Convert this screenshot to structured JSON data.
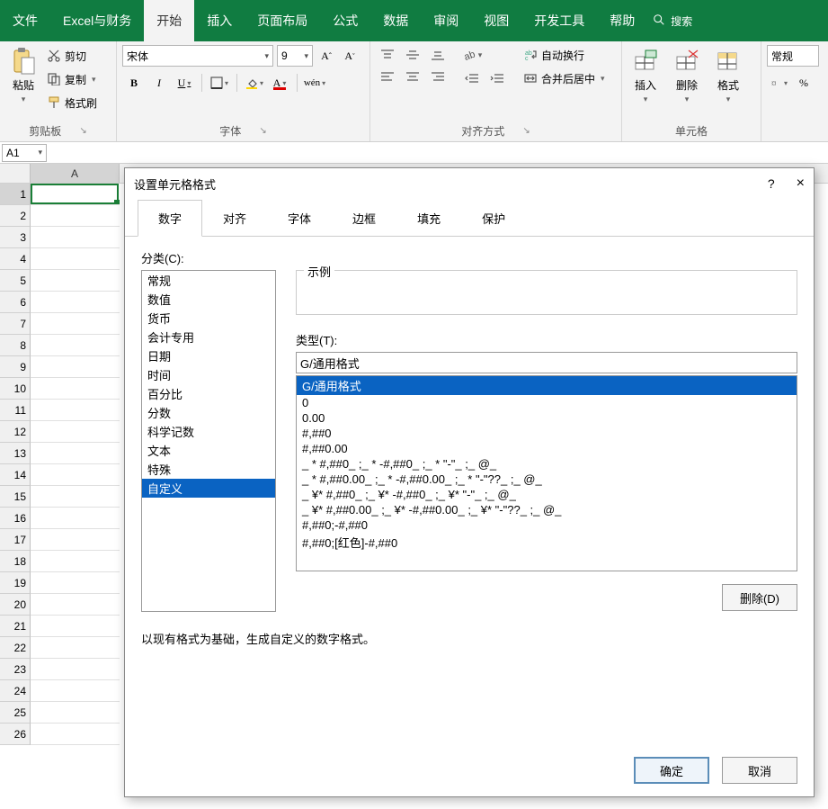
{
  "tabs": {
    "file": "文件",
    "finance": "Excel与财务",
    "home": "开始",
    "insert": "插入",
    "layout": "页面布局",
    "formula": "公式",
    "data": "数据",
    "review": "审阅",
    "view": "视图",
    "dev": "开发工具",
    "help": "帮助",
    "search": "搜索"
  },
  "ribbon": {
    "clipboard": {
      "paste": "粘贴",
      "cut": "剪切",
      "copy": "复制",
      "painter": "格式刷",
      "label": "剪贴板"
    },
    "font": {
      "name": "宋体",
      "size": "9",
      "label": "字体",
      "bold": "B",
      "italic": "I",
      "underline": "U"
    },
    "align": {
      "label": "对齐方式",
      "wrap": "自动换行",
      "merge": "合并后居中"
    },
    "cells": {
      "insert": "插入",
      "delete": "删除",
      "format": "格式",
      "label": "单元格"
    },
    "numfmt": "常规"
  },
  "namebox": "A1",
  "colA": "A",
  "dialog": {
    "title": "设置单元格格式",
    "help": "?",
    "close": "×",
    "tabs": {
      "number": "数字",
      "align": "对齐",
      "font": "字体",
      "border": "边框",
      "fill": "填充",
      "protect": "保护"
    },
    "category_label": "分类(C):",
    "categories": [
      "常规",
      "数值",
      "货币",
      "会计专用",
      "日期",
      "时间",
      "百分比",
      "分数",
      "科学记数",
      "文本",
      "特殊",
      "自定义"
    ],
    "selected_category": "自定义",
    "sample_label": "示例",
    "type_label": "类型(T):",
    "type_value": "G/通用格式",
    "formats": [
      "G/通用格式",
      "0",
      "0.00",
      "#,##0",
      "#,##0.00",
      "_ * #,##0_ ;_ * -#,##0_ ;_ * \"-\"_ ;_ @_ ",
      "_ * #,##0.00_ ;_ * -#,##0.00_ ;_ * \"-\"??_ ;_ @_ ",
      "_ ¥* #,##0_ ;_ ¥* -#,##0_ ;_ ¥* \"-\"_ ;_ @_ ",
      "_ ¥* #,##0.00_ ;_ ¥* -#,##0.00_ ;_ ¥* \"-\"??_ ;_ @_ ",
      "#,##0;-#,##0",
      "#,##0;[红色]-#,##0"
    ],
    "selected_format": "G/通用格式",
    "delete_btn": "删除(D)",
    "hint": "以现有格式为基础，生成自定义的数字格式。",
    "ok": "确定",
    "cancel": "取消"
  }
}
